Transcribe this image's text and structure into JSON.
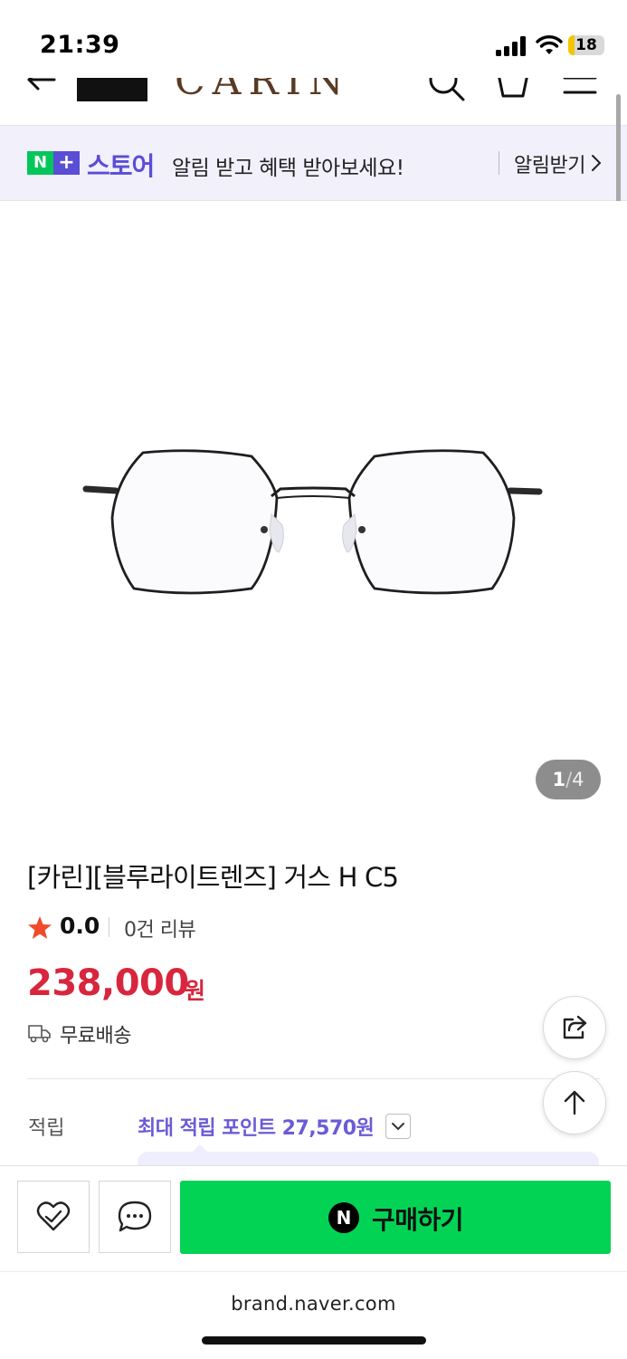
{
  "status_bar": {
    "time": "21:39",
    "battery": "18",
    "battery_level": 0.18,
    "icons": [
      "cellular-signal-icon",
      "wifi-icon",
      "battery-icon"
    ]
  },
  "header": {
    "brand_logo": "CARIN",
    "icons": [
      "back-arrow-icon",
      "search-icon",
      "cart-icon",
      "menu-icon"
    ]
  },
  "store_banner": {
    "badge_n": "N",
    "badge_plus": "+",
    "store_label": "스토어",
    "message": "알림 받고 혜택 받아보세요!",
    "link_label": "알림받기"
  },
  "gallery": {
    "current": "1",
    "separator": "/",
    "total": "4"
  },
  "product": {
    "title": "[카린][블루라이트렌즈] 거스 H C5",
    "rating": "0.0",
    "review_count": "0건 리뷰",
    "price": "238,000",
    "price_unit": "원",
    "shipping": "무료배송"
  },
  "points": {
    "label": "적립",
    "text": "최대 적립 포인트 27,570원"
  },
  "actions": {
    "buy_badge": "N",
    "buy_label": "구매하기"
  },
  "browser": {
    "url": "brand.naver.com"
  },
  "colors": {
    "naver_green": "#03c75a",
    "buy_green": "#03d354",
    "store_purple": "#5a4dd6",
    "price_red": "#d7263d",
    "points_purple": "#6b5bd6",
    "brand_brown": "#5a3a24"
  }
}
